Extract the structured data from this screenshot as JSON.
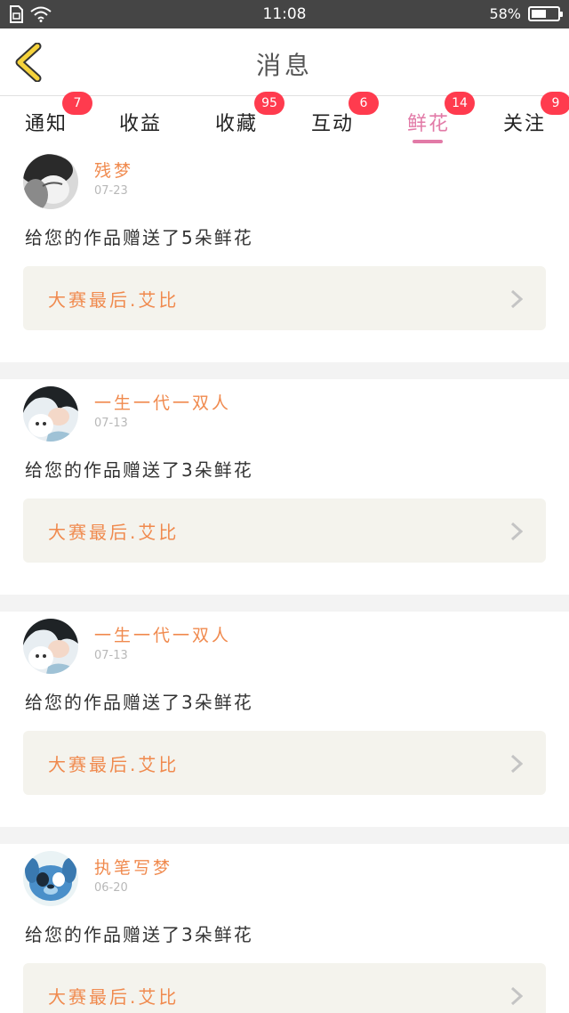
{
  "status_bar": {
    "time": "11:08",
    "battery_percent": "58%",
    "battery_level": 0.58,
    "icons": [
      "sim-icon",
      "wifi-icon",
      "battery-icon"
    ]
  },
  "nav": {
    "title": "消息",
    "back_icon": "back-arrow-icon"
  },
  "tabs": [
    {
      "label": "通知",
      "badge": "7",
      "active": false
    },
    {
      "label": "收益",
      "badge": "",
      "active": false
    },
    {
      "label": "收藏",
      "badge": "95",
      "active": false
    },
    {
      "label": "互动",
      "badge": "6",
      "active": false
    },
    {
      "label": "鲜花",
      "badge": "14",
      "active": true
    },
    {
      "label": "关注",
      "badge": "9",
      "active": false
    }
  ],
  "messages": [
    {
      "username": "残梦",
      "date": "07-23",
      "text": "给您的作品赠送了5朵鲜花",
      "work_title": "大赛最后.艾比"
    },
    {
      "username": "一生一代一双人",
      "date": "07-13",
      "text": "给您的作品赠送了3朵鲜花",
      "work_title": "大赛最后.艾比"
    },
    {
      "username": "一生一代一双人",
      "date": "07-13",
      "text": "给您的作品赠送了3朵鲜花",
      "work_title": "大赛最后.艾比"
    },
    {
      "username": "执笔写梦",
      "date": "06-20",
      "text": "给您的作品赠送了3朵鲜花",
      "work_title": "大赛最后.艾比"
    }
  ],
  "colors": {
    "status_bar_bg": "#454545",
    "accent_pink": "#e27aa7",
    "badge_red": "#ff3b4e",
    "username_orange": "#f08a4e",
    "back_arrow_yellow": "#f6d33c",
    "work_card_bg": "#f4f3ed"
  }
}
